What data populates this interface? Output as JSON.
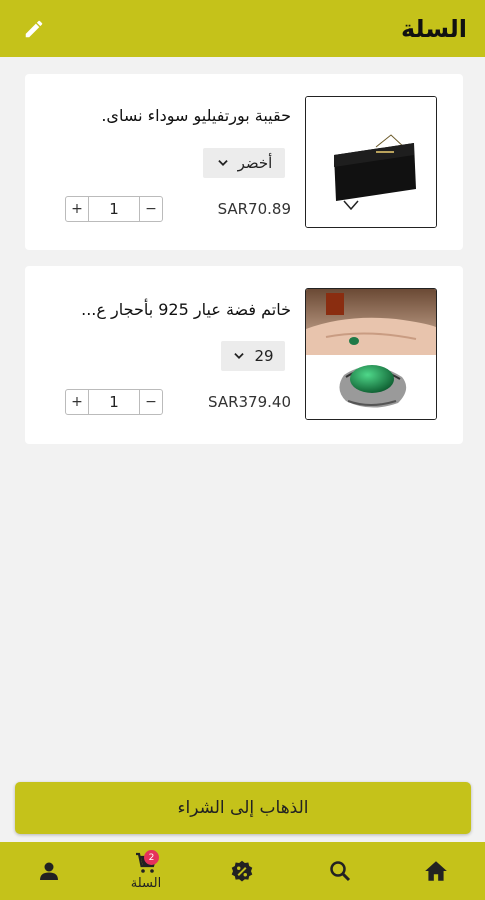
{
  "header": {
    "title": "السلة",
    "edit_icon": "pencil-icon"
  },
  "cart": {
    "items": [
      {
        "name": "حقيبة بورتفيليو سوداء نساى.",
        "variant": "أخضر",
        "price": "SAR70.89",
        "quantity": "1",
        "image": "black-clutch-bag"
      },
      {
        "name": "خاتم فضة عيار 925 بأحجار ع...",
        "variant": "29",
        "price": "SAR379.40",
        "quantity": "1",
        "image": "silver-ring-green-stone"
      }
    ],
    "increment": "+",
    "decrement": "−"
  },
  "checkout": {
    "label": "الذهاب إلى الشراء"
  },
  "bottom_nav": {
    "cart_label": "السلة",
    "cart_badge": "2",
    "items": [
      "home-icon",
      "search-icon",
      "discount-icon",
      "cart-icon",
      "profile-icon"
    ]
  },
  "colors": {
    "accent": "#c5c21a",
    "badge": "#e5325b",
    "background": "#f2f2f2"
  }
}
